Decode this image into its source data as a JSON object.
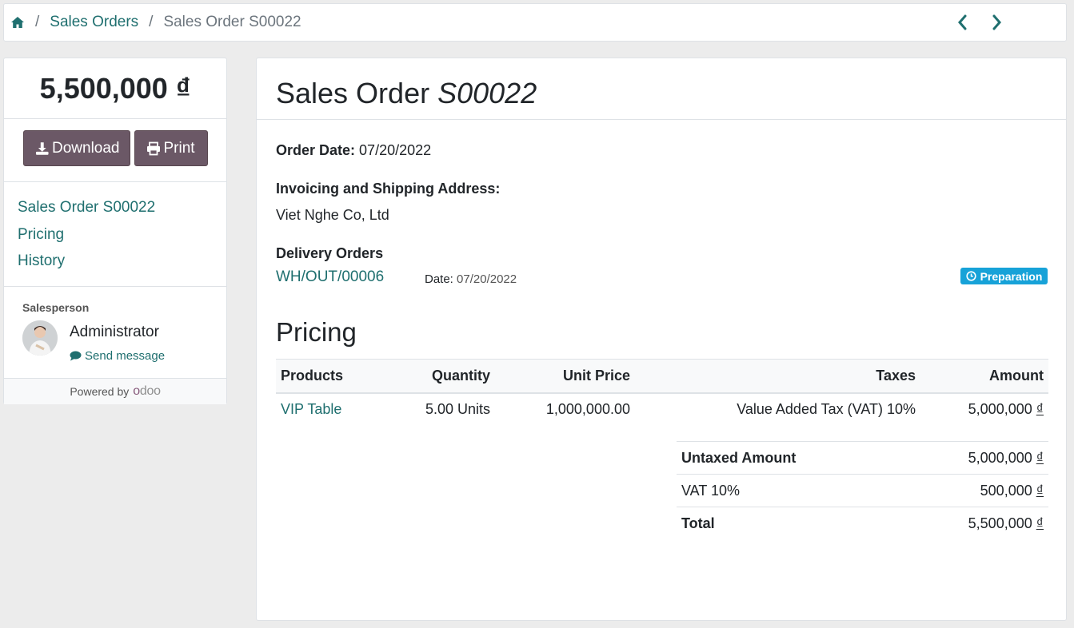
{
  "breadcrumb": {
    "home_icon": "home-icon",
    "items": [
      "Sales Orders",
      "Sales Order S00022"
    ]
  },
  "sidebar": {
    "total": "5,500,000 ₫",
    "download_label": "Download",
    "print_label": "Print",
    "nav": [
      "Sales Order S00022",
      "Pricing",
      "History"
    ],
    "salesperson_label": "Salesperson",
    "salesperson_name": "Administrator",
    "send_message": "Send message",
    "powered_by": "Powered by",
    "brand": "odoo"
  },
  "order": {
    "title_prefix": "Sales Order",
    "title_number": "S00022",
    "order_date_label": "Order Date:",
    "order_date": "07/20/2022",
    "address_label": "Invoicing and Shipping Address:",
    "address": "Viet Nghe Co, Ltd",
    "delivery_label": "Delivery Orders",
    "delivery_ref": "WH/OUT/00006",
    "delivery_date_label": "Date:",
    "delivery_date": "07/20/2022",
    "delivery_status": "Preparation"
  },
  "pricing": {
    "title": "Pricing",
    "columns": [
      "Products",
      "Quantity",
      "Unit Price",
      "Taxes",
      "Amount"
    ],
    "lines": [
      {
        "product": "VIP Table",
        "quantity": "5.00 Units",
        "unit_price": "1,000,000.00",
        "taxes": "Value Added Tax (VAT) 10%",
        "amount": "5,000,000",
        "currency": "₫"
      }
    ],
    "totals": [
      {
        "label": "Untaxed Amount",
        "value": "5,000,000",
        "currency": "₫",
        "bold": true
      },
      {
        "label": "VAT 10%",
        "value": "500,000",
        "currency": "₫",
        "bold": false
      },
      {
        "label": "Total",
        "value": "5,500,000",
        "currency": "₫",
        "bold": true
      }
    ]
  },
  "colors": {
    "link": "#1f6f6f",
    "button": "#6b5866",
    "badge": "#17a2d8"
  }
}
